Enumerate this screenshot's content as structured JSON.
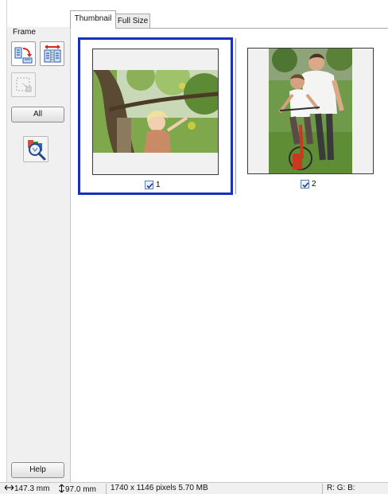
{
  "tabs": [
    {
      "label": "Thumbnail",
      "active": true
    },
    {
      "label": "Full Size",
      "active": false
    }
  ],
  "sidebar": {
    "frame_label": "Frame",
    "tools": [
      {
        "name": "rotate-icon"
      },
      {
        "name": "flip-icon"
      },
      {
        "name": "marquee-icon",
        "disabled": true
      }
    ],
    "all_label": "All",
    "auto_locate_icon": "auto-locate-magnifier-icon",
    "help_label": "Help"
  },
  "thumbnails": [
    {
      "number": "1",
      "checked": true,
      "selected": true,
      "description_icon": "photo-thumbnail"
    },
    {
      "number": "2",
      "checked": true,
      "selected": false,
      "description_icon": "photo-thumbnail"
    }
  ],
  "status": {
    "width": "147.3 mm",
    "height": "97.0 mm",
    "info": "1740 x 1146 pixels 5.70 MB",
    "rgb": "R: G: B:"
  },
  "colors": {
    "selection_border": "#1b2fbf",
    "panel_bg": "#f0f0f0"
  }
}
